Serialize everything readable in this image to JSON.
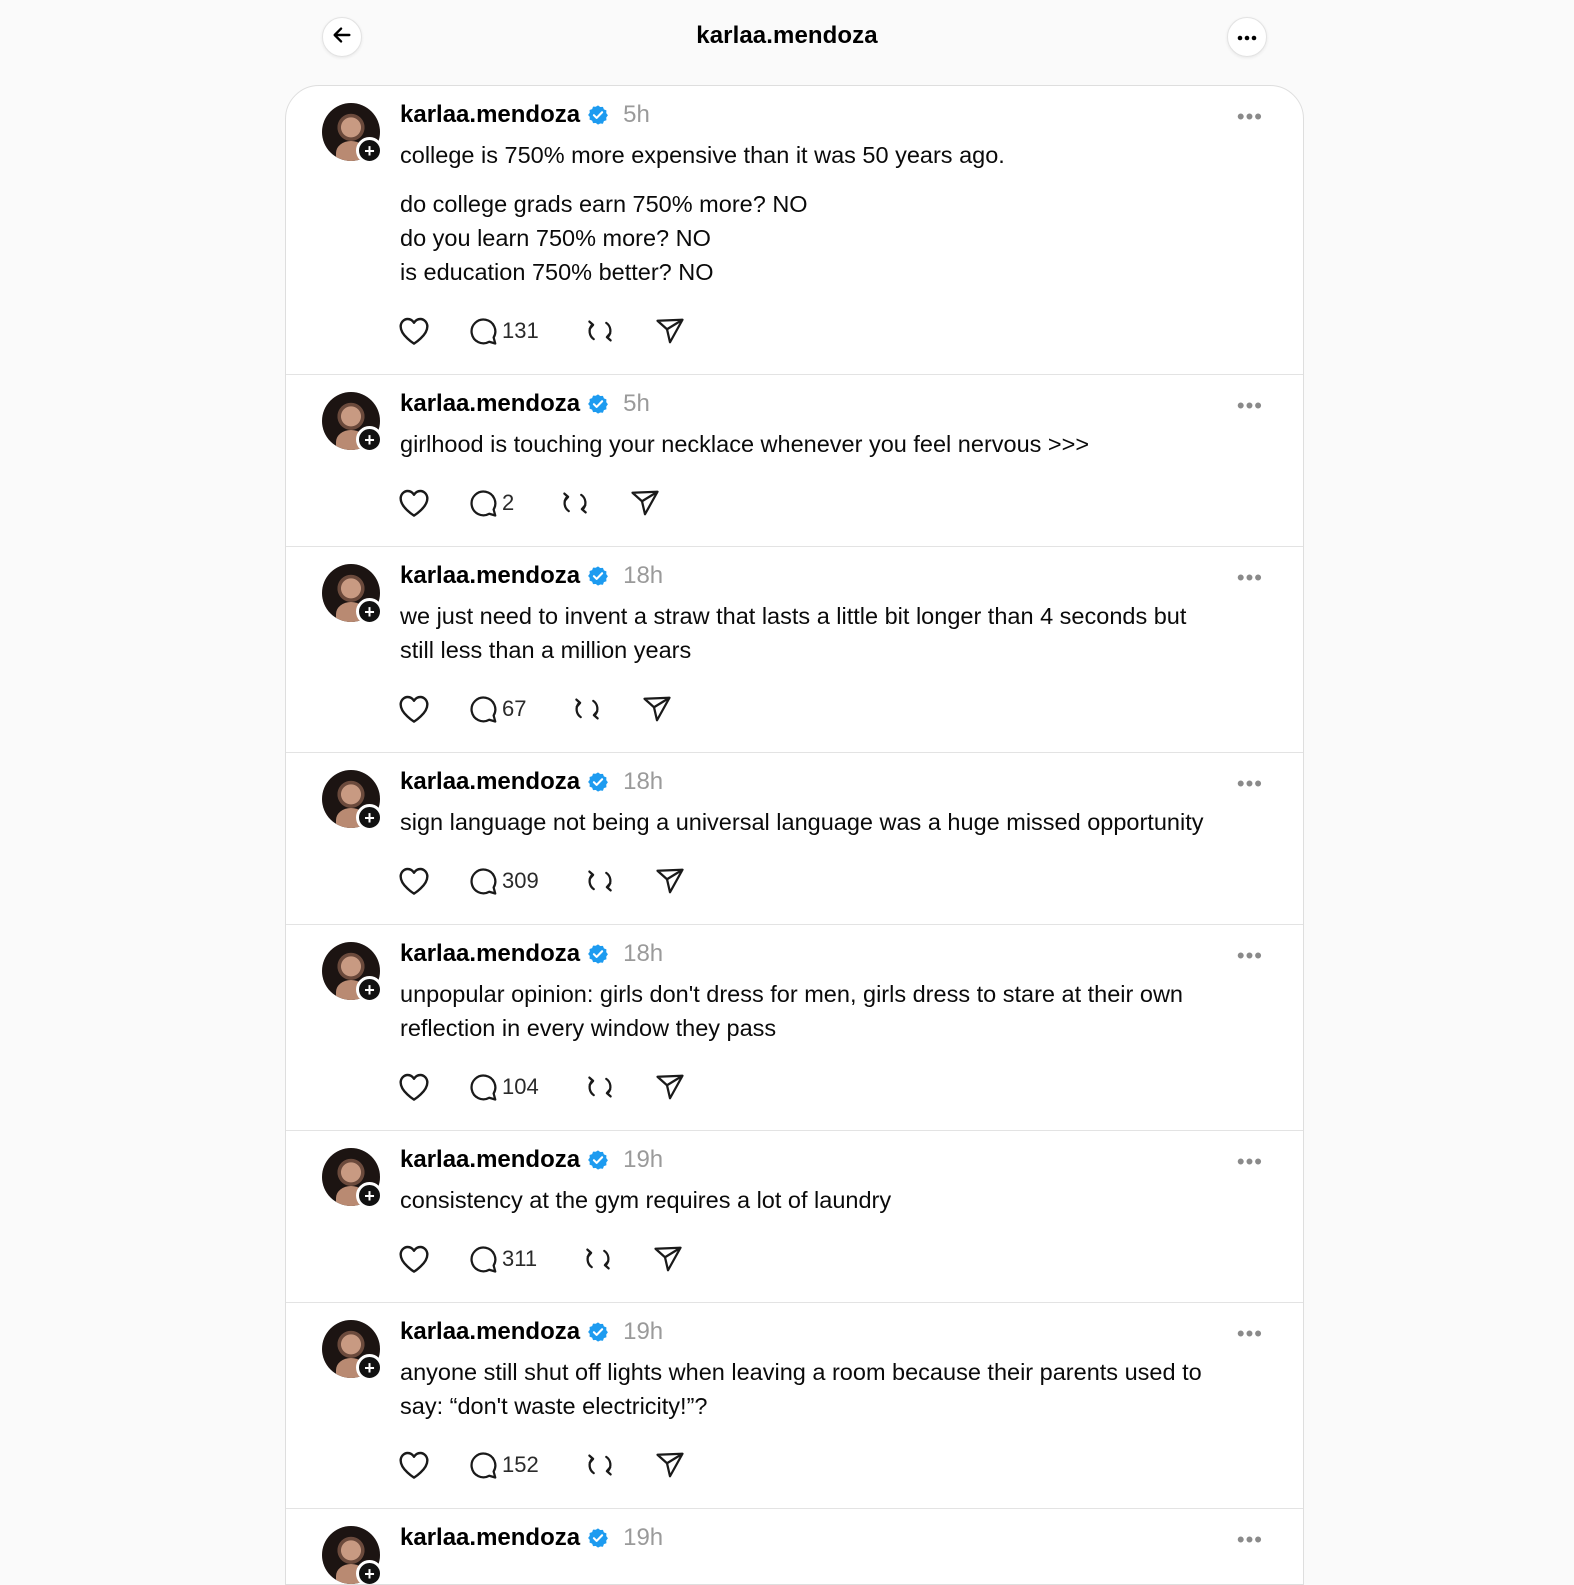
{
  "header": {
    "title": "karlaa.mendoza",
    "back_icon": "arrow-left-icon",
    "more_icon": "more-horizontal-icon"
  },
  "colors": {
    "verified": "#1d9bf0",
    "timestamp": "#9a9a9a",
    "background": "#fafafa"
  },
  "posts": [
    {
      "username": "karlaa.mendoza",
      "time": "5h",
      "paragraphs": [
        "college is 750% more expensive than it was 50 years ago.",
        "do college grads earn 750% more? NO\ndo you learn 750% more? NO\nis education 750% better? NO"
      ],
      "replies": "131"
    },
    {
      "username": "karlaa.mendoza",
      "time": "5h",
      "paragraphs": [
        "girlhood is touching your necklace whenever you feel nervous >>>"
      ],
      "replies": "2"
    },
    {
      "username": "karlaa.mendoza",
      "time": "18h",
      "paragraphs": [
        "we just need to invent a straw that lasts a little bit longer than 4 seconds but\nstill less than a million years"
      ],
      "replies": "67"
    },
    {
      "username": "karlaa.mendoza",
      "time": "18h",
      "paragraphs": [
        "sign language not being a universal language was a huge missed opportunity"
      ],
      "replies": "309"
    },
    {
      "username": "karlaa.mendoza",
      "time": "18h",
      "paragraphs": [
        "unpopular opinion: girls don't dress for men, girls dress to stare at their own\nreflection in every window they pass"
      ],
      "replies": "104"
    },
    {
      "username": "karlaa.mendoza",
      "time": "19h",
      "paragraphs": [
        "consistency at the gym requires a lot of laundry"
      ],
      "replies": "311"
    },
    {
      "username": "karlaa.mendoza",
      "time": "19h",
      "paragraphs": [
        "anyone still shut off lights when leaving a room because their parents used to\nsay: “don't waste electricity!”?"
      ],
      "replies": "152"
    },
    {
      "username": "karlaa.mendoza",
      "time": "19h",
      "paragraphs": [],
      "replies": ""
    }
  ]
}
